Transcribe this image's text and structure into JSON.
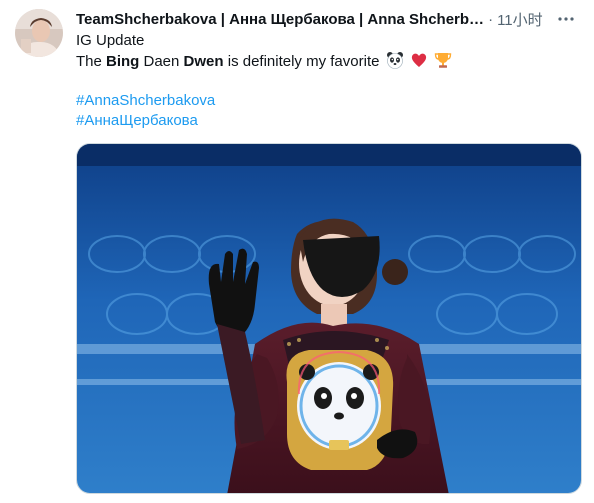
{
  "tweet": {
    "author": "TeamShcherbakova | Анна Щербакова | Anna Shcherb…",
    "separator": "·",
    "time": "11小时",
    "more_icon": "more-dots-icon",
    "line1": "IG Update",
    "line2_a": "The ",
    "line2_b": "Bing",
    "line2_c": " Daen ",
    "line2_d": "Dwen",
    "line2_e": " is definitely my favorite",
    "emojis": [
      "panda-face-icon",
      "red-heart-icon",
      "trophy-icon"
    ],
    "hashtag1": "#AnnaShcherbakova",
    "hashtag2": "#АннаЩербакова"
  },
  "colors": {
    "accent": "#1d9bf0",
    "text": "#0f1419",
    "muted": "#536471"
  },
  "media": {
    "type": "photo",
    "subject": "skater-with-mascot-photo"
  }
}
